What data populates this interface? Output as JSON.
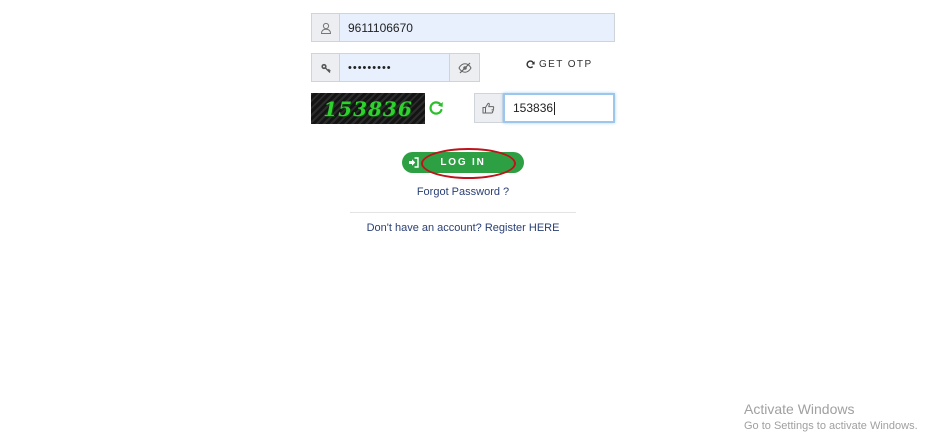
{
  "login_form": {
    "username": {
      "value": "9611106670",
      "icon": "user-icon"
    },
    "password": {
      "masked_value": "•••••••••",
      "key_icon": "key-icon",
      "toggle_icon": "eye-slash-icon"
    },
    "otp": {
      "label": "GET OTP",
      "icon": "refresh-icon"
    },
    "captcha": {
      "image_text": "153836",
      "refresh_icon": "circular-refresh-icon",
      "input_icon": "hand-pointer-icon",
      "input_value": "153836",
      "captcha_color": "#2fd12f"
    },
    "login_button": {
      "label": "LOG IN",
      "icon": "sign-in-icon",
      "color": "#2ea044"
    },
    "forgot_password": "Forgot Password ?",
    "register": "Don't have an account? Register HERE"
  },
  "windows_watermark": {
    "title": "Activate Windows",
    "subtitle": "Go to Settings to activate Windows."
  }
}
